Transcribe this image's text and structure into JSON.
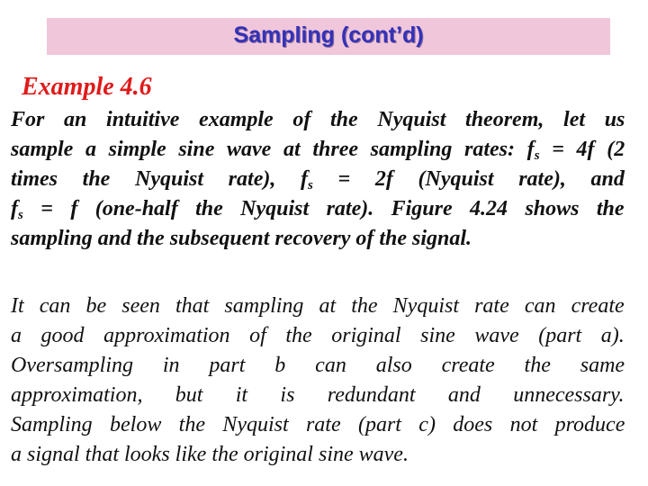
{
  "header": {
    "title": "Sampling (cont’d)",
    "background_color": "#f0c6da",
    "title_color": "#3333b8"
  },
  "example": {
    "heading": "Example 4.6",
    "heading_color": "#e01a1a"
  },
  "paragraph1": {
    "lines": [
      {
        "text": "For an intuitive example of the Nyquist theorem, let us"
      },
      {
        "pre": "sample a simple sine wave at three sampling rates: f",
        "sub": "s",
        "post": " = 4f (2"
      },
      {
        "pre": "times the Nyquist rate), f",
        "sub": "s",
        "post": " = 2f (Nyquist rate), and"
      },
      {
        "pre": "f",
        "sub": "s",
        "post": " = f (one-half the Nyquist rate). Figure 4.24 shows the"
      },
      {
        "text": "sampling and the subsequent recovery of the signal."
      }
    ]
  },
  "paragraph2": {
    "lines": [
      "It can be seen that sampling at the Nyquist rate can create",
      "a good approximation of the original sine wave (part a).",
      "Oversampling in part b can also create the same",
      "approximation, but it is redundant and unnecessary.",
      "Sampling below the Nyquist rate (part c) does not produce",
      "a signal that looks like the original sine wave."
    ]
  }
}
